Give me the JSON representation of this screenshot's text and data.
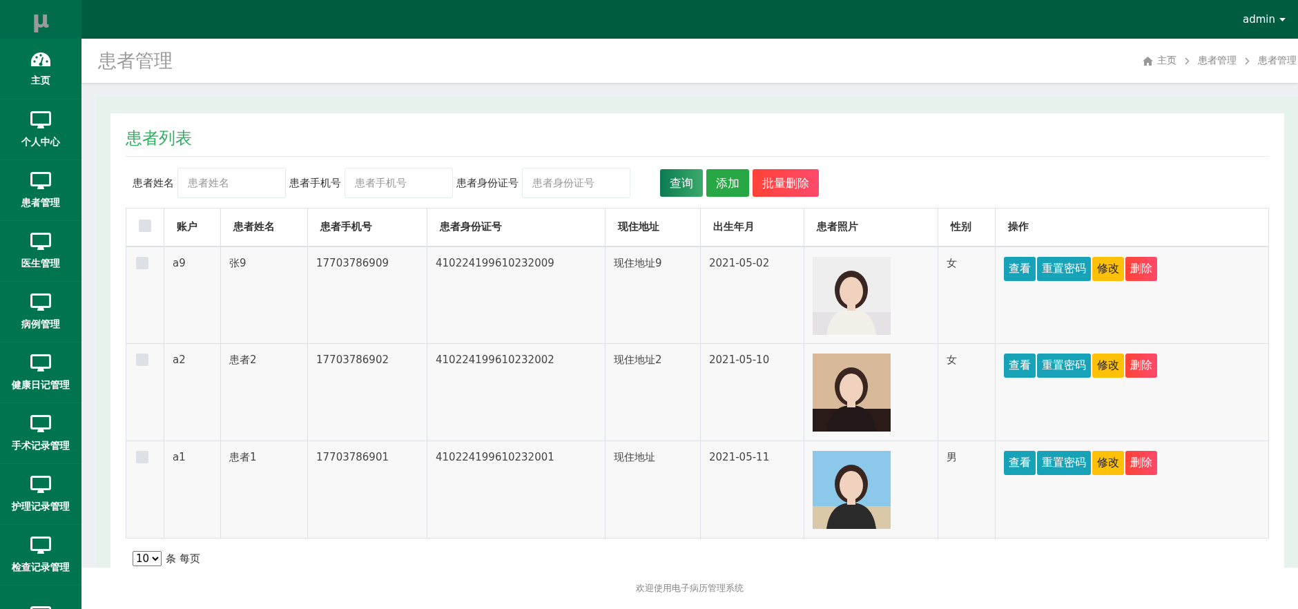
{
  "logo": "µ",
  "user": {
    "name": "admin"
  },
  "sidebar": {
    "items": [
      {
        "label": "主页",
        "kind": "dashboard"
      },
      {
        "label": "个人中心",
        "kind": "monitor"
      },
      {
        "label": "患者管理",
        "kind": "monitor"
      },
      {
        "label": "医生管理",
        "kind": "monitor"
      },
      {
        "label": "病例管理",
        "kind": "monitor"
      },
      {
        "label": "健康日记管理",
        "kind": "monitor"
      },
      {
        "label": "手术记录管理",
        "kind": "monitor"
      },
      {
        "label": "护理记录管理",
        "kind": "monitor"
      },
      {
        "label": "检查记录管理",
        "kind": "monitor"
      }
    ]
  },
  "page_title": "患者管理",
  "breadcrumb": [
    "主页",
    "患者管理",
    "患者管理"
  ],
  "card_title": "患者列表",
  "search": {
    "fields": [
      {
        "label": "患者姓名",
        "placeholder": "患者姓名"
      },
      {
        "label": "患者手机号",
        "placeholder": "患者手机号"
      },
      {
        "label": "患者身份证号",
        "placeholder": "患者身份证号"
      }
    ],
    "buttons": [
      {
        "label": "查询",
        "kind": "query"
      },
      {
        "label": "添加",
        "kind": "add"
      },
      {
        "label": "批量删除",
        "kind": "danger"
      }
    ]
  },
  "table": {
    "select_all": {
      "checked": false
    },
    "columns": [
      "账户",
      "患者姓名",
      "患者手机号",
      "患者身份证号",
      "现住地址",
      "出生年月",
      "患者照片",
      "性别",
      "操作"
    ],
    "rows": [
      {
        "checked": false,
        "cells": [
          "a9",
          "张9",
          "17703786909",
          "410224199610232009",
          "现住地址9",
          "2021-05-02"
        ],
        "gender": "女",
        "actions": [
          {
            "label": "查看",
            "kind": "info"
          },
          {
            "label": "重置密码",
            "kind": "info"
          },
          {
            "label": "修改",
            "kind": "warning"
          },
          {
            "label": "删除",
            "kind": "danger"
          }
        ]
      },
      {
        "checked": false,
        "cells": [
          "a2",
          "患者2",
          "17703786902",
          "410224199610232002",
          "现住地址2",
          "2021-05-10"
        ],
        "gender": "女",
        "actions": [
          {
            "label": "查看",
            "kind": "info"
          },
          {
            "label": "重置密码",
            "kind": "info"
          },
          {
            "label": "修改",
            "kind": "warning"
          },
          {
            "label": "删除",
            "kind": "danger"
          }
        ]
      },
      {
        "checked": false,
        "cells": [
          "a1",
          "患者1",
          "17703786901",
          "410224199610232001",
          "现住地址",
          "2021-05-11"
        ],
        "gender": "男",
        "actions": [
          {
            "label": "查看",
            "kind": "info"
          },
          {
            "label": "重置密码",
            "kind": "info"
          },
          {
            "label": "修改",
            "kind": "warning"
          },
          {
            "label": "删除",
            "kind": "danger"
          }
        ]
      }
    ]
  },
  "pagination": {
    "page_size": "10",
    "unit": "条 每页"
  },
  "footer": "欢迎使用电子病历管理系统"
}
